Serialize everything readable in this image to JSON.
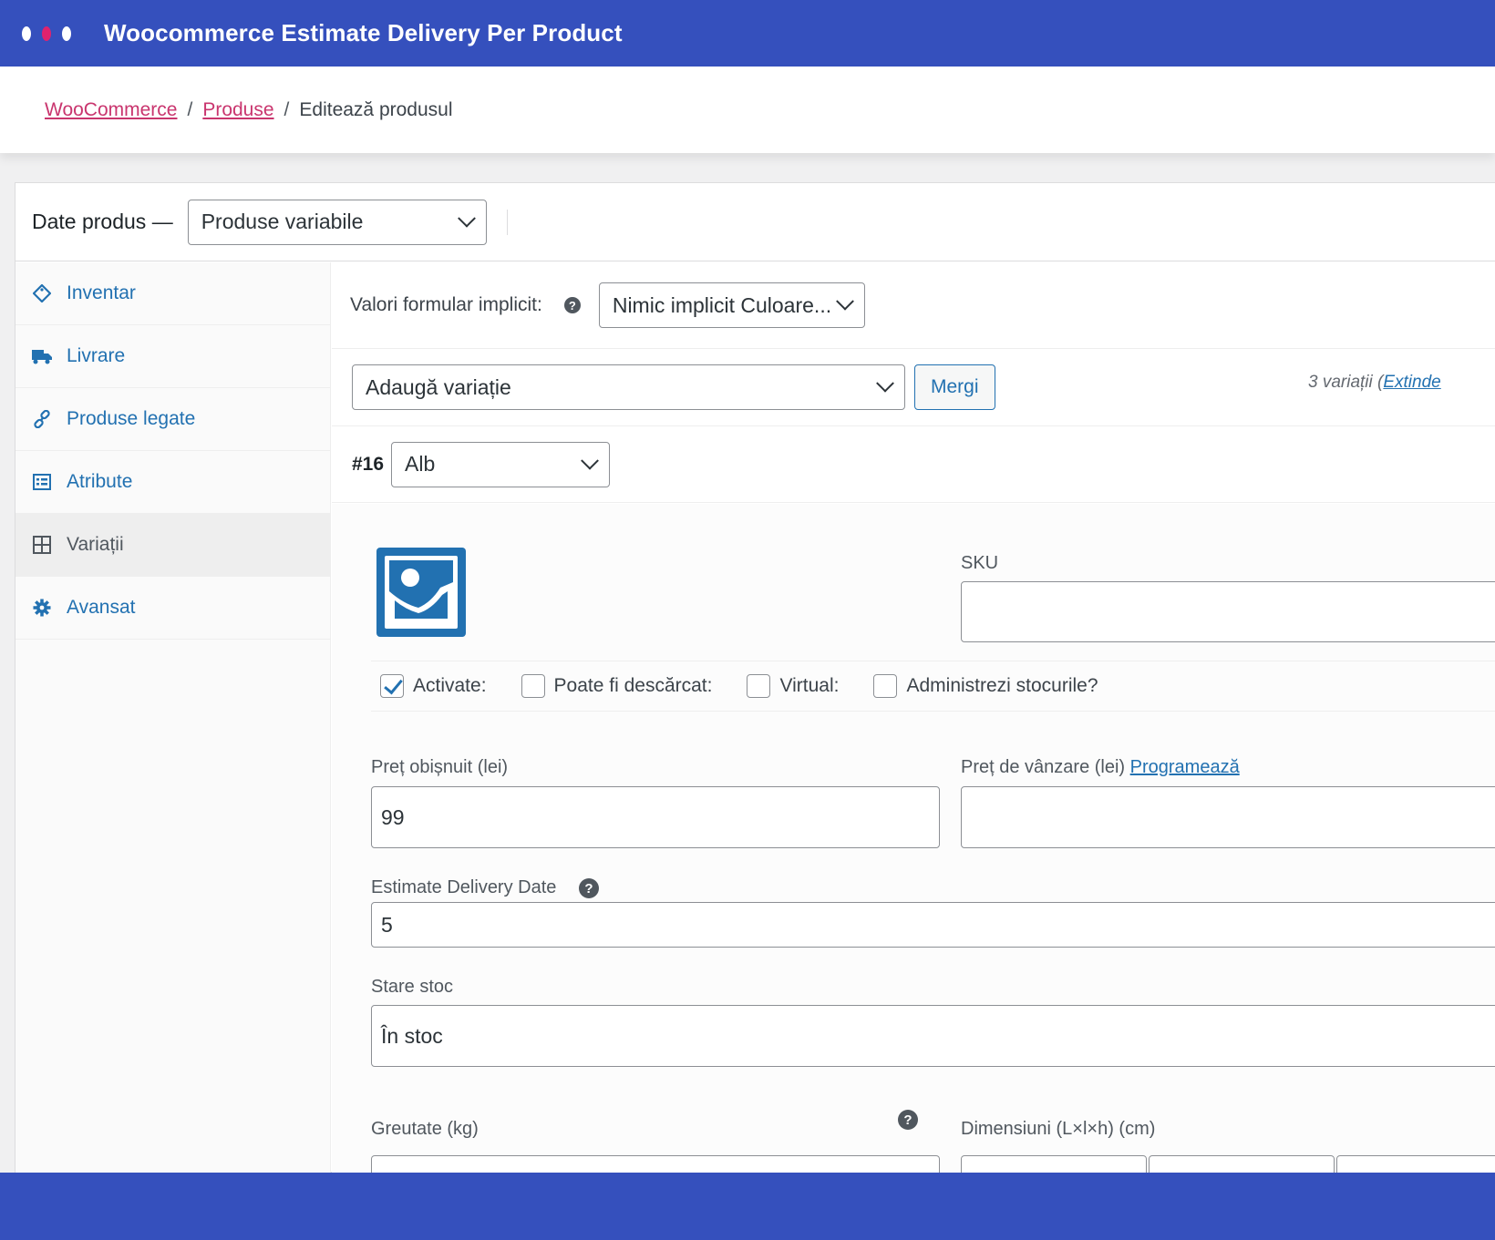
{
  "app": {
    "title": "Woocommerce Estimate Delivery Per Product"
  },
  "breadcrumb": {
    "items": [
      "WooCommerce",
      "Produse"
    ],
    "current": "Editează produsul",
    "separator": "/"
  },
  "product_data": {
    "label": "Date produs —",
    "type_select": "Produse variabile"
  },
  "sidebar": {
    "items": [
      {
        "label": "Inventar",
        "icon": "tag-icon"
      },
      {
        "label": "Livrare",
        "icon": "truck-icon"
      },
      {
        "label": "Produse legate",
        "icon": "link-icon"
      },
      {
        "label": "Atribute",
        "icon": "list-icon"
      },
      {
        "label": "Variații",
        "icon": "grid-icon",
        "active": true
      },
      {
        "label": "Avansat",
        "icon": "gear-icon"
      }
    ]
  },
  "defaults": {
    "label": "Valori formular implicit:",
    "select": "Nimic implicit Culoare..."
  },
  "add_variation": {
    "select": "Adaugă variație",
    "button": "Mergi",
    "count_text": "3 variații (",
    "expand_link": "Extinde"
  },
  "variation": {
    "number": "#16",
    "attribute_select": "Alb",
    "sku_label": "SKU",
    "sku_value": "",
    "checkboxes": [
      {
        "label": "Activate:",
        "checked": true
      },
      {
        "label": "Poate fi descărcat:",
        "checked": false
      },
      {
        "label": "Virtual:",
        "checked": false
      },
      {
        "label": "Administrezi stocurile?",
        "checked": false
      }
    ],
    "regular_price_label": "Preț obișnuit (lei)",
    "regular_price_value": "99",
    "sale_price_label": "Preț de vânzare (lei)",
    "sale_schedule_link": "Programează",
    "sale_price_value": "",
    "delivery_label": "Estimate Delivery Date",
    "delivery_value": "5",
    "stock_label": "Stare stoc",
    "stock_value": "În stoc",
    "weight_label": "Greutate (kg)",
    "dimensions_label": "Dimensiuni (L×l×h) (cm)"
  },
  "colors": {
    "brand": "#3550bd",
    "link": "#2271b1",
    "breadcrumb_link": "#c9356e"
  }
}
